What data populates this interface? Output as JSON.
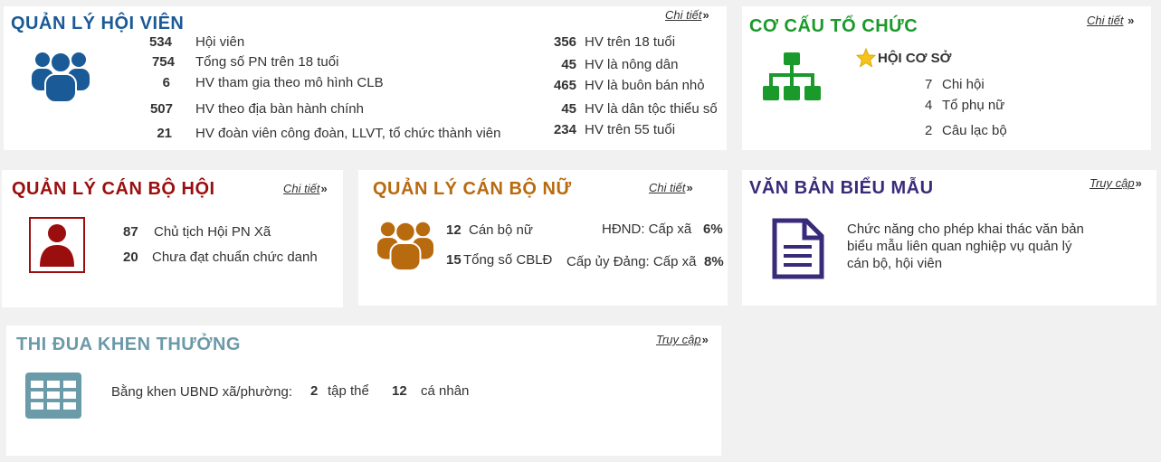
{
  "colors": {
    "blue": "#1a5a96",
    "green": "#1a9a2a",
    "red": "#9b0e0e",
    "orange": "#b86a0f",
    "purple": "#3a2a7a",
    "teal": "#6b9aa8"
  },
  "hoi_vien": {
    "title": "QUẢN LÝ HỘI VIÊN",
    "link": "Chi tiết",
    "icon": "users-icon",
    "left": [
      {
        "value": "534",
        "label": "Hội viên"
      },
      {
        "value": "754",
        "label": "Tổng số PN trên 18 tuổi"
      },
      {
        "value": "6",
        "label": "HV tham gia theo mô hình CLB"
      },
      {
        "value": "507",
        "label": "HV theo địa bàn hành chính"
      },
      {
        "value": "21",
        "label": "HV đoàn viên công đoàn, LLVT, tổ chức thành viên"
      }
    ],
    "right": [
      {
        "value": "356",
        "label": "HV trên 18 tuổi"
      },
      {
        "value": "45",
        "label": "HV là nông dân"
      },
      {
        "value": "465",
        "label": "HV là buôn bán nhỏ"
      },
      {
        "value": "45",
        "label": "HV là dân tộc thiểu số"
      },
      {
        "value": "234",
        "label": "HV trên 55 tuổi"
      }
    ]
  },
  "co_cau": {
    "title": "CƠ CẤU TỔ CHỨC",
    "link": "Chi tiết",
    "icon": "org-chart-icon",
    "star_icon": "star-icon",
    "subtitle": "HỘI CƠ SỞ",
    "items": [
      {
        "value": "7",
        "label": "Chi hội"
      },
      {
        "value": "4",
        "label": "Tổ phụ nữ"
      },
      {
        "value": "2",
        "label": "Câu lạc bộ"
      }
    ]
  },
  "can_bo_hoi": {
    "title": "QUẢN LÝ CÁN BỘ HỘI",
    "link": "Chi tiết",
    "icon": "user-icon",
    "items": [
      {
        "value": "87",
        "label": "Chủ tịch Hội PN Xã"
      },
      {
        "value": "20",
        "label": "Chưa đạt chuẩn chức danh"
      }
    ]
  },
  "can_bo_nu": {
    "title": "QUẢN LÝ CÁN BỘ NỮ",
    "link": "Chi tiết",
    "icon": "users-icon",
    "left": [
      {
        "value": "12",
        "label": "Cán bộ nữ"
      },
      {
        "value": "15",
        "label": "Tổng số CBLĐ"
      }
    ],
    "right": [
      {
        "label": "HĐND: Cấp xã",
        "value": "6%"
      },
      {
        "label": "Cấp ủy Đảng: Cấp xã",
        "value": "8%"
      }
    ]
  },
  "van_ban": {
    "title": "VĂN BẢN BIỂU MẪU",
    "link": "Truy cập",
    "icon": "document-icon",
    "lines": [
      "Chức năng cho phép khai thác văn bản",
      "biểu mẫu liên quan nghiệp vụ quản lý",
      "cán bộ, hội viên"
    ]
  },
  "thi_dua": {
    "title": "THI ĐUA KHEN THƯỞNG",
    "link": "Truy cập",
    "icon": "table-icon",
    "label": "Bằng khen UBND xã/phường:",
    "v1": "2",
    "l1": "tập thể",
    "v2": "12",
    "l2": "cá nhân"
  }
}
